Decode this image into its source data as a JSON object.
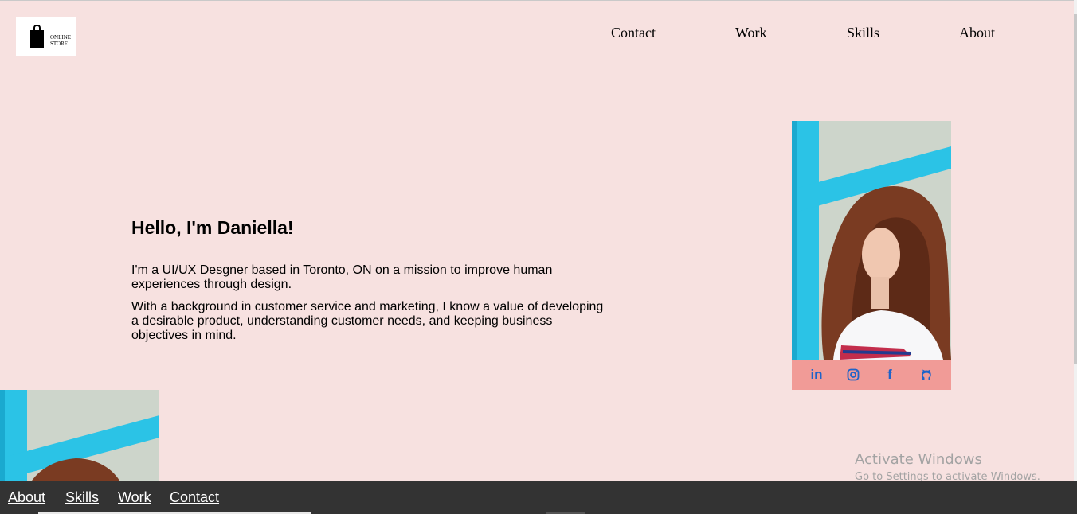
{
  "header": {
    "logo_text_line1": "ONLINE",
    "logo_text_line2": "STORE",
    "nav": [
      "Contact",
      "Work",
      "Skills",
      "About"
    ]
  },
  "hero": {
    "title": "Hello, I'm Daniella!",
    "paragraph1": "I'm a UI/UX Desgner based in Toronto, ON on a mission to improve human experiences through design.",
    "paragraph2": "With a background in customer service and marketing, I know a value of developing a desirable product, understanding customer needs, and keeping business objectives in mind."
  },
  "social": {
    "linkedin": "in",
    "instagram": "instagram-icon",
    "facebook": "f",
    "github": "github-icon",
    "icon_color": "#1e63c9",
    "bar_color": "#f19b97"
  },
  "watermark": {
    "title": "Activate Windows",
    "subtitle": "Go to Settings to activate Windows."
  },
  "footer": {
    "links": [
      "About",
      "Skills",
      "Work",
      "Contact"
    ]
  },
  "colors": {
    "background": "#f7e1e0",
    "footer": "#333333"
  }
}
